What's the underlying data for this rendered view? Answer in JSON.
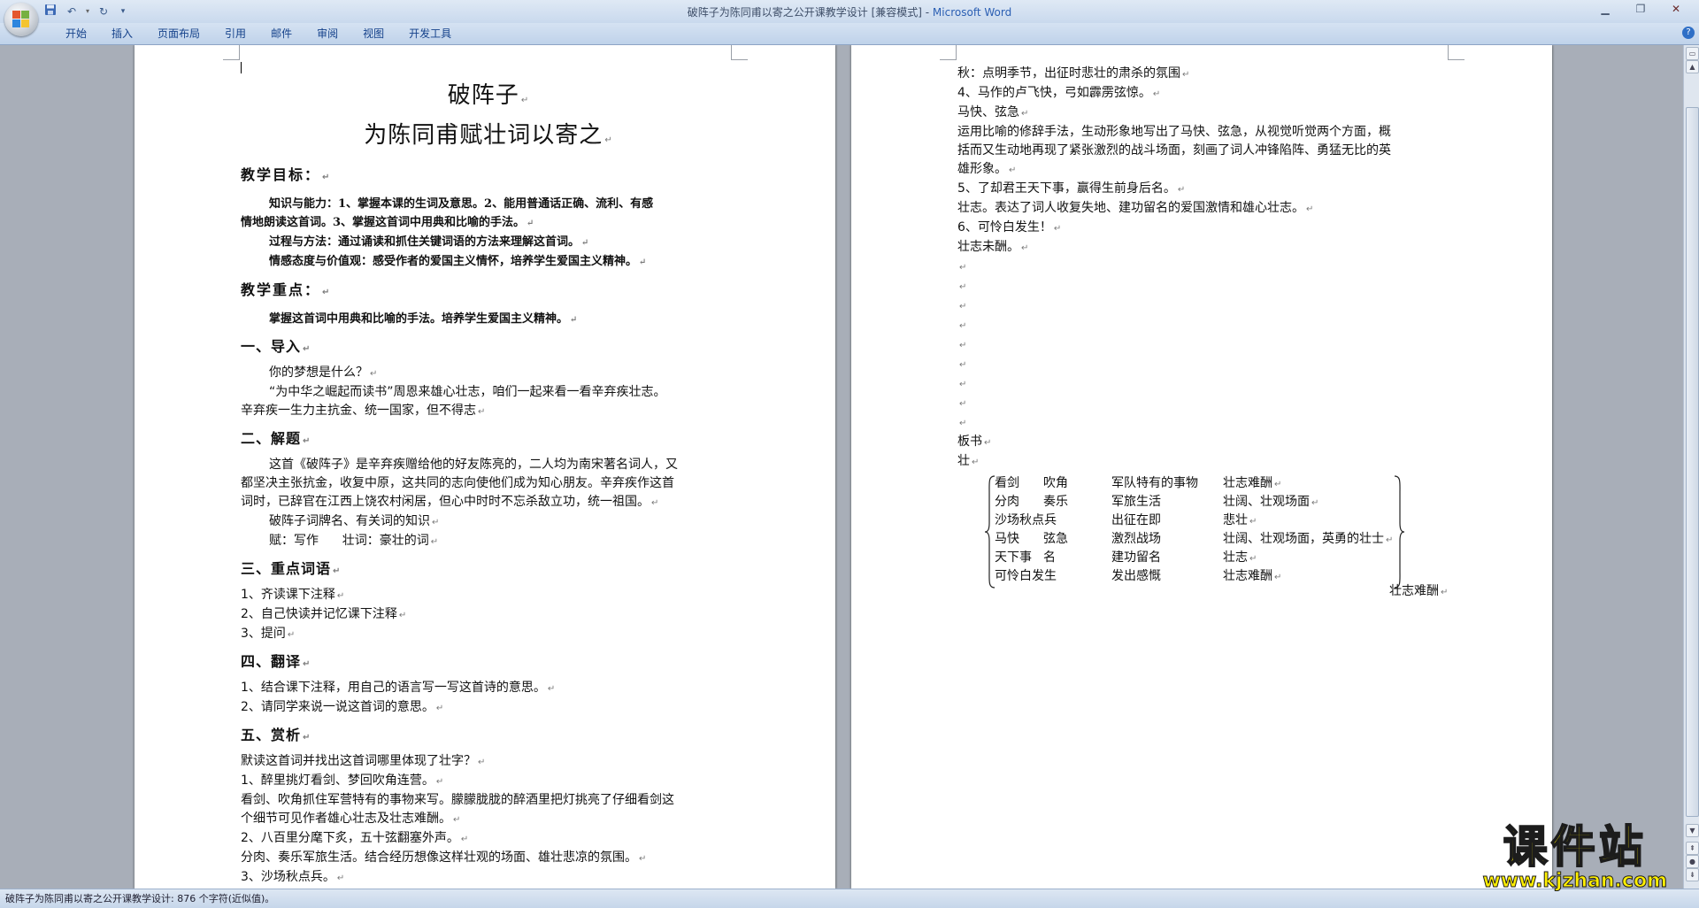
{
  "window": {
    "title_doc": "破阵子为陈同甫以寄之公开课教学设计 [兼容模式] - ",
    "title_app": "Microsoft Word"
  },
  "ribbon": {
    "tabs": [
      "开始",
      "插入",
      "页面布局",
      "引用",
      "邮件",
      "审阅",
      "视图",
      "开发工具"
    ]
  },
  "page1": {
    "title": "破阵子",
    "subtitle": "为陈同甫赋壮词以寄之",
    "goals_heading": "教学目标：",
    "goals_1a": "知识与能力：1、掌握本课的生词及意思。2、能用普通话正确、流利、有感",
    "goals_1b": "情地朗读这首词。3、掌握这首词中用典和比喻的手法。",
    "goals_2": "过程与方法：通过诵读和抓住关键词语的方法来理解这首词。",
    "goals_3": "情感态度与价值观：感受作者的爱国主义情怀，培养学生爱国主义精神。",
    "focus_heading": "教学重点：",
    "focus_text": "掌握这首词中用典和比喻的手法。培养学生爱国主义精神。",
    "s1_heading": "一、导入",
    "s1_l1": "你的梦想是什么？",
    "s1_l2": "“为中华之崛起而读书”周恩来雄心壮志，咱们一起来看一看辛弃疾壮志。",
    "s1_l3": "辛弃疾一生力主抗金、统一国家，但不得志",
    "s2_heading": "二、解题",
    "s2_l1": "这首《破阵子》是辛弃疾赠给他的好友陈亮的，二人均为南宋著名词人，又",
    "s2_l2": "都坚决主张抗金，收复中原，这共同的志向使他们成为知心朋友。辛弃疾作这首",
    "s2_l3": "词时，已辞官在江西上饶农村闲居，但心中时时不忘杀敌立功，统一祖国。",
    "s2_l4": "破阵子词牌名、有关词的知识",
    "s2_l5": "赋：写作      壮词：豪壮的词",
    "s3_heading": "三、重点词语",
    "s3_items": [
      "1、齐读课下注释",
      "2、自己快读并记忆课下注释",
      "3、提问"
    ],
    "s4_heading": "四、翻译",
    "s4_items": [
      "1、结合课下注释，用自己的语言写一写这首诗的意思。",
      "2、请同学来说一说这首词的意思。"
    ],
    "s5_heading": "五、赏析",
    "s5_l1": "默读这首词并找出这首词哪里体现了壮字？",
    "s5_l2": "1、醉里挑灯看剑、梦回吹角连营。",
    "s5_l3": "看剑、吹角抓住军营特有的事物来写。朦朦胧胧的醉酒里把灯挑亮了仔细看剑这",
    "s5_l4": "个细节可见作者雄心壮志及壮志难酬。",
    "s5_l5": "2、八百里分麾下炙，五十弦翻塞外声。",
    "s5_l6": "分肉、奏乐军旅生活。结合经历想像这样壮观的场面、雄壮悲凉的氛围。",
    "s5_l7": "3、沙场秋点兵。"
  },
  "page2": {
    "l1": "秋：点明季节，出征时悲壮的肃杀的氛围",
    "l2": "4、马作的卢飞快，弓如霹雳弦惊。",
    "l3": "马快、弦急",
    "l4": "运用比喻的修辞手法，生动形象地写出了马快、弦急，从视觉听觉两个方面，概",
    "l5": "括而又生动地再现了紧张激烈的战斗场面，刻画了词人冲锋陷阵、勇猛无比的英",
    "l6": "雄形象。",
    "l7": "5、了却君王天下事，赢得生前身后名。",
    "l8": "壮志。表达了词人收复失地、建功留名的爱国激情和雄心壮志。",
    "l9": "6、可怜白发生！",
    "l10": "壮志未酬。",
    "board_title": "板书",
    "board_char": "壮",
    "board_rows": [
      {
        "a": "看剑",
        "b": "吹角",
        "c": "军队特有的事物",
        "d": "壮志难酬"
      },
      {
        "a": "分肉",
        "b": "奏乐",
        "c": "军旅生活",
        "d": "壮阔、壮观场面"
      },
      {
        "a": "沙场秋点兵",
        "b": "",
        "c": "出征在即",
        "d": "悲壮"
      },
      {
        "a": "马快",
        "b": "弦急",
        "c": "激烈战场",
        "d": "壮阔、壮观场面，英勇的壮士"
      },
      {
        "a": "天下事",
        "b": "名",
        "c": "建功留名",
        "d": "壮志"
      },
      {
        "a": "可怜白发生",
        "b": "",
        "c": "发出感慨",
        "d": "壮志难酬"
      }
    ],
    "board_summary": "壮志难酬"
  },
  "status": {
    "text": "破阵子为陈同甫以寄之公开课教学设计: 876 个字符(近似值)。"
  },
  "watermark": {
    "main": "课件站",
    "url": "www.kjzhan.com"
  },
  "colors": {
    "accent": "#15428b",
    "watermark_fill": "#ffef00"
  }
}
